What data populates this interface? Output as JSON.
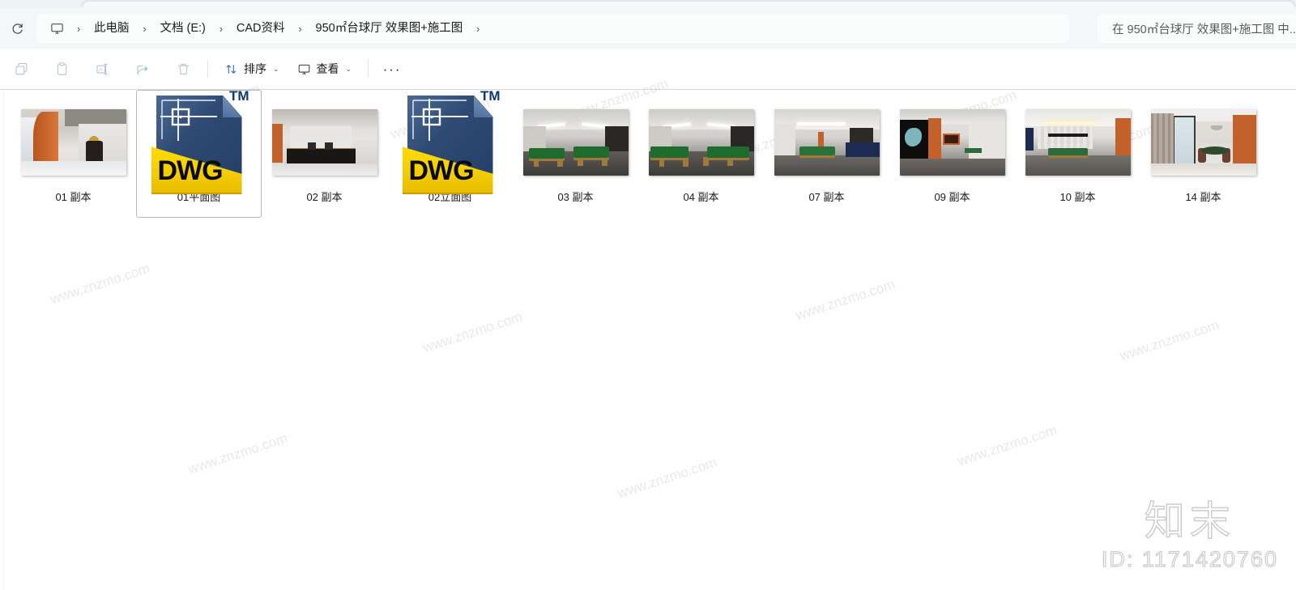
{
  "window": {
    "tab_title": "950㎡台球厅 效果图+施工图"
  },
  "address_bar": {
    "refresh_icon": "refresh-icon",
    "root_icon": "this-pc-icon",
    "separator": "›",
    "crumbs": [
      {
        "label": "此电脑"
      },
      {
        "label": "文档 (E:)"
      },
      {
        "label": "CAD资料"
      },
      {
        "label": "950㎡台球厅 效果图+施工图"
      }
    ]
  },
  "search": {
    "placeholder": "在 950㎡台球厅 效果图+施工图 中..."
  },
  "toolbar": {
    "icons": [
      {
        "name": "copy-icon",
        "tooltip": "复制"
      },
      {
        "name": "paste-icon",
        "tooltip": "粘贴"
      },
      {
        "name": "rename-icon",
        "tooltip": "重命名"
      },
      {
        "name": "share-icon",
        "tooltip": "共享"
      },
      {
        "name": "delete-icon",
        "tooltip": "删除"
      }
    ],
    "sort_label": "排序",
    "view_label": "查看",
    "more_label": "···",
    "chevron": "⌄"
  },
  "files": [
    {
      "label": "01 副本",
      "kind": "photo",
      "scene": "s01",
      "selected": false
    },
    {
      "label": "01平面图",
      "kind": "dwg",
      "scene": "dwg",
      "selected": true,
      "badge": "DWG",
      "tm": "TM"
    },
    {
      "label": "02 副本",
      "kind": "photo",
      "scene": "s02",
      "selected": false
    },
    {
      "label": "02立面图",
      "kind": "dwg",
      "scene": "dwg",
      "selected": false,
      "badge": "DWG",
      "tm": "TM"
    },
    {
      "label": "03 副本",
      "kind": "photo",
      "scene": "sbil",
      "selected": false
    },
    {
      "label": "04 副本",
      "kind": "photo",
      "scene": "sbil v4",
      "selected": false
    },
    {
      "label": "07 副本",
      "kind": "photo",
      "scene": "s07",
      "selected": false
    },
    {
      "label": "09 副本",
      "kind": "photo",
      "scene": "s09",
      "selected": false
    },
    {
      "label": "10 副本",
      "kind": "photo",
      "scene": "s10",
      "selected": false
    },
    {
      "label": "14 副本",
      "kind": "photo",
      "scene": "s14",
      "selected": false
    }
  ],
  "watermark": {
    "tile_text": "www.znzmo.com",
    "brand": "知末",
    "id": "ID: 1171420760"
  },
  "colors": {
    "chrome_bg": "#f3f7f9",
    "content_bg": "#ffffff",
    "selection_border": "#b9b9b9",
    "dwg_yellow": "#f7d000",
    "dwg_blue": "#2f4a72"
  }
}
